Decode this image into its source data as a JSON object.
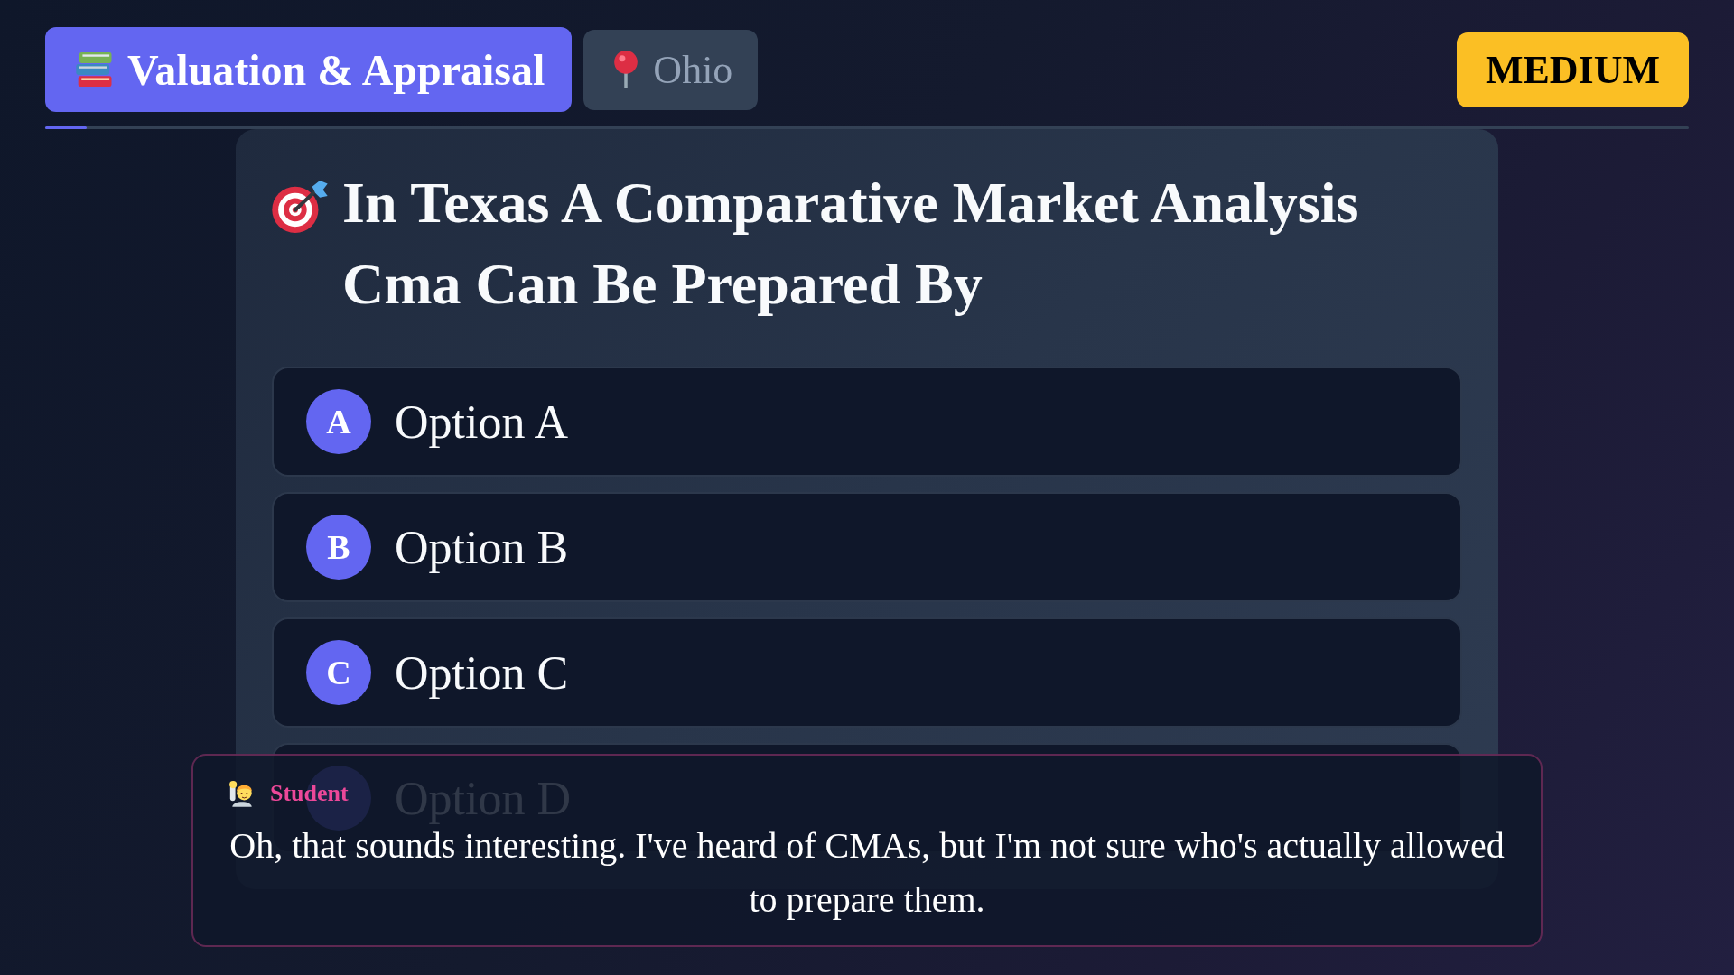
{
  "header": {
    "category": "Valuation & Appraisal",
    "location": "Ohio",
    "difficulty": "MEDIUM"
  },
  "progress": {
    "level": 0.025
  },
  "question": {
    "title": "In Texas A Comparative Market Analysis Cma Can Be Prepared By",
    "options": [
      {
        "letter": "A",
        "text": "Option A",
        "selected": false
      },
      {
        "letter": "B",
        "text": "Option B",
        "selected": false
      },
      {
        "letter": "C",
        "text": "Option C",
        "selected": false
      },
      {
        "text": "Option D",
        "selected": false
      }
    ]
  },
  "caption": {
    "speaker": "Student",
    "text": "Oh, that sounds interesting. I've heard of CMAs, but I'm not sure who's actually allowed to prepare them."
  }
}
